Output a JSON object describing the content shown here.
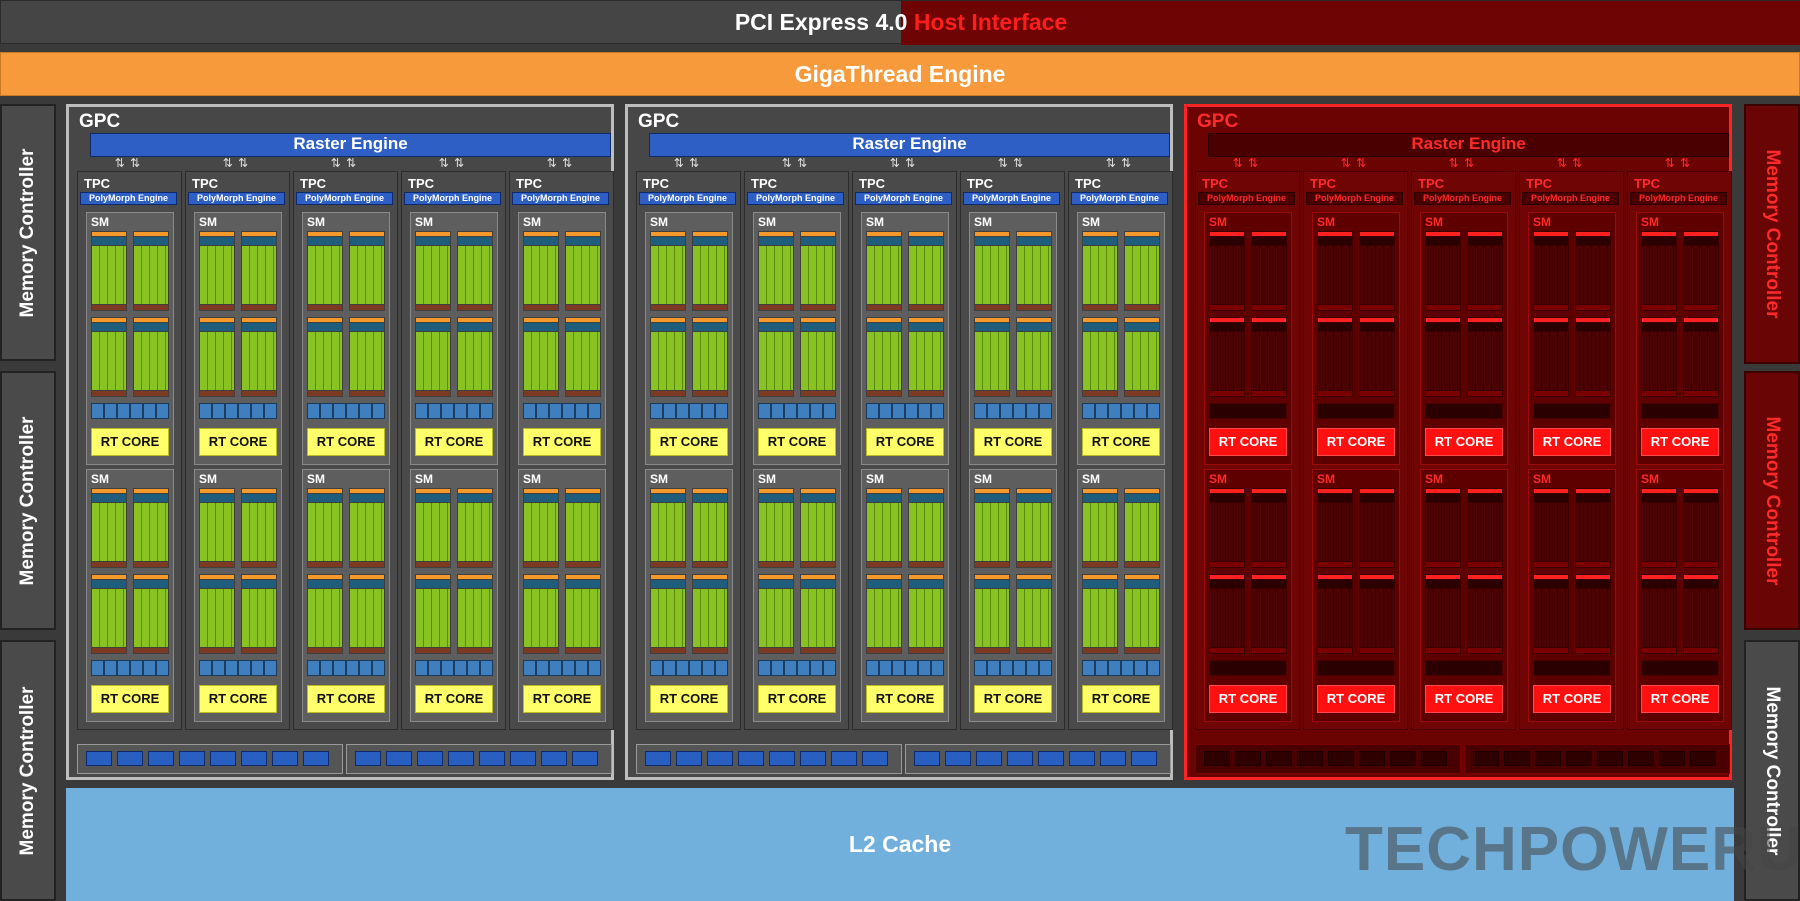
{
  "host": {
    "left_text": "PCI Express 4.0",
    "right_text": "Host Interface"
  },
  "giga": {
    "label": "GigaThread Engine"
  },
  "memory_controller": {
    "label": "Memory Controller"
  },
  "l2": {
    "label": "L2 Cache"
  },
  "gpc": {
    "label": "GPC",
    "raster_label": "Raster Engine",
    "tpc_label": "TPC",
    "polymorph_label": "PolyMorph Engine",
    "sm_label": "SM",
    "rt_core_label": "RT CORE",
    "count": 3,
    "tpcs_per_gpc": 5,
    "sms_per_tpc": 2,
    "disabled_gpc_index": 2
  },
  "watermark": {
    "text": "TECHPOWERUP"
  },
  "colors": {
    "disabled_overlay": "#ff1d1d",
    "giga": "#f79a3c",
    "l2": "#71b0dc",
    "raster": "#2e5fc5",
    "rt_core": "#ffff6a",
    "cuda": "#88c321"
  }
}
